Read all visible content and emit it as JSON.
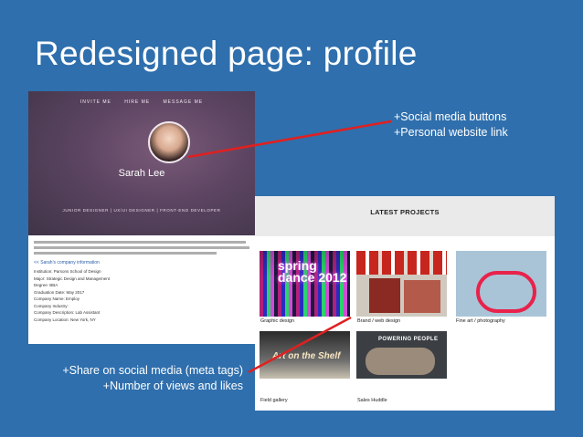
{
  "slide": {
    "title": "Redesigned page: profile"
  },
  "profile": {
    "nav": [
      "INVITE ME",
      "HIRE ME",
      "MESSAGE ME"
    ],
    "name": "Sarah Lee",
    "roles": "JUNIOR DESIGNER | UX/UI DESIGNER | FRONT-END DEVELOPER",
    "company_link": "<< Sarah's company information",
    "details": [
      "Institution: Parsons School of Design",
      "Major: Strategic Design and Management",
      "Degree: BBA",
      "Graduation Date: May 2017",
      "Company Name: Employ",
      "Company Industry:",
      "Company Description: Lab Assistant",
      "Company Location: New York, NY"
    ]
  },
  "projects": {
    "header": "LATEST PROJECTS",
    "tiles": [
      {
        "label": "Graphic design",
        "art_text": "spring dance 2012"
      },
      {
        "label": "Brand / web design"
      },
      {
        "label": "Fine art / photography"
      },
      {
        "label": "Field gallery",
        "art_text": "Art on the Shelf"
      },
      {
        "label": "Sales Huddle",
        "art_text": "POWERING PEOPLE"
      }
    ]
  },
  "annotations": {
    "top": [
      "+Social media buttons",
      "+Personal website link"
    ],
    "bottom": [
      "+Share on social media (meta tags)",
      "+Number of views and likes"
    ]
  },
  "colors": {
    "background": "#2f6fad",
    "arrow": "#e02020"
  }
}
